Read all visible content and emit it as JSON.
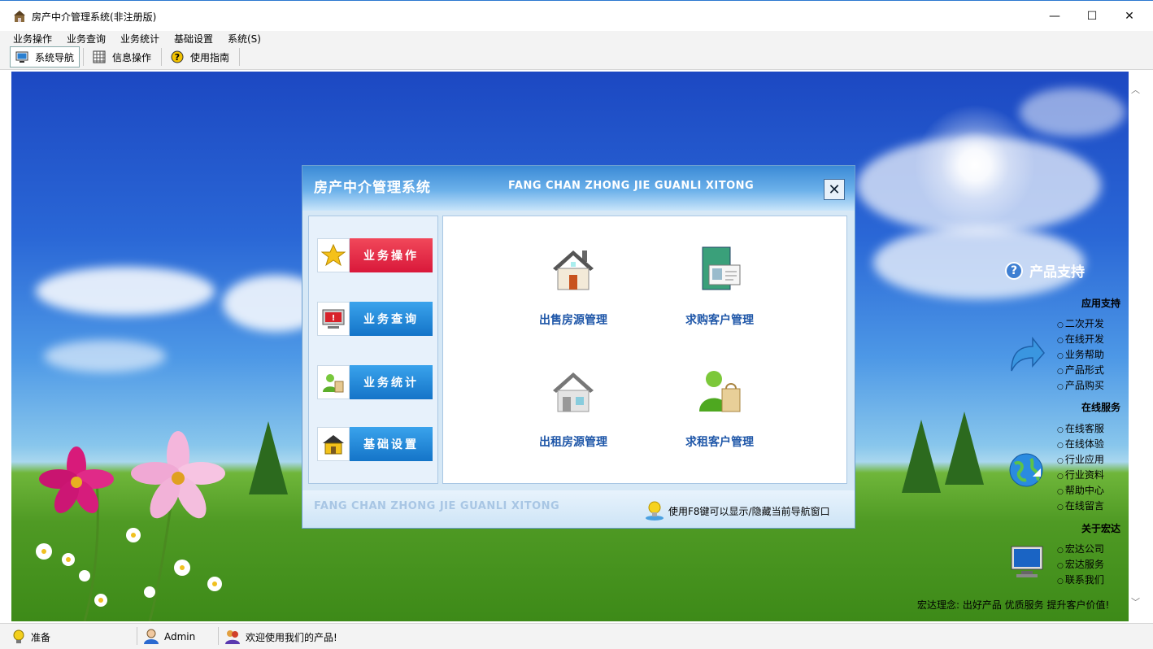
{
  "window": {
    "title": "房产中介管理系统(非注册版)",
    "min_glyph": "—",
    "max_glyph": "☐",
    "close_glyph": "✕"
  },
  "menu": [
    "业务操作",
    "业务查询",
    "业务统计",
    "基础设置",
    "系统(S)"
  ],
  "toolbar": {
    "items": [
      {
        "label": "系统导航",
        "icon": "monitor-icon",
        "active": true
      },
      {
        "label": "信息操作",
        "icon": "grid-icon",
        "active": false
      },
      {
        "label": "使用指南",
        "icon": "help-icon",
        "active": false
      }
    ]
  },
  "dialog": {
    "title": "房产中介管理系统",
    "subtitle": "FANG CHAN ZHONG JIE GUANLI XITONG",
    "close_glyph": "✕",
    "nav": [
      {
        "label": "业务操作",
        "icon": "star-icon",
        "color": "red"
      },
      {
        "label": "业务查询",
        "icon": "alert-monitor-icon",
        "color": "blue"
      },
      {
        "label": "业务统计",
        "icon": "users-icon",
        "color": "blue"
      },
      {
        "label": "基础设置",
        "icon": "house-icon",
        "color": "blue"
      }
    ],
    "functions": [
      {
        "label": "出售房源管理",
        "icon": "sale-house-icon"
      },
      {
        "label": "求购客户管理",
        "icon": "contact-card-icon"
      },
      {
        "label": "出租房源管理",
        "icon": "rent-house-icon"
      },
      {
        "label": "求租客户管理",
        "icon": "customer-bag-icon"
      }
    ],
    "footer_en": "FANG CHAN ZHONG JIE GUANLI XITONG",
    "footer_tip": "使用F8键可以显示/隐藏当前导航窗口"
  },
  "support": {
    "title": "产品支持",
    "groups": [
      {
        "head": "应用支持",
        "items": [
          "二次开发",
          "在线开发",
          "业务帮助",
          "产品形式",
          "产品购买"
        ]
      },
      {
        "head": "在线服务",
        "items": [
          "在线客服",
          "在线体验",
          "行业应用",
          "行业资料",
          "帮助中心",
          "在线留言"
        ]
      },
      {
        "head": "关于宏达",
        "items": [
          "宏达公司",
          "宏达服务",
          "联系我们"
        ]
      }
    ],
    "motto": "宏达理念: 出好产品 优质服务 提升客户价值!"
  },
  "status": {
    "ready": "准备",
    "user": "Admin",
    "welcome": "欢迎使用我们的产品!"
  },
  "colors": {
    "accent_red": "#d9183a",
    "accent_blue": "#1474c8",
    "func_text": "#1e56a8"
  }
}
